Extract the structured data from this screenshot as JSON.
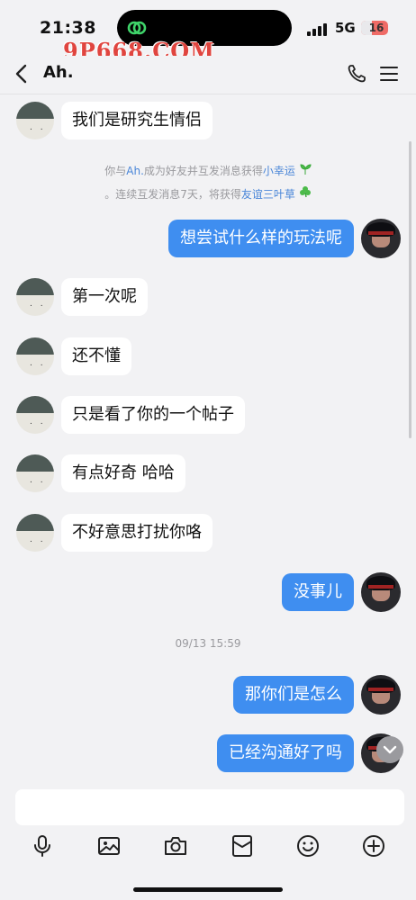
{
  "status": {
    "time": "21:38",
    "network": "5G",
    "battery": "16",
    "watermark": "9P668.COM"
  },
  "header": {
    "title": "Ah."
  },
  "system_notice": {
    "line1_prefix": "你与",
    "line1_name": "Ah.",
    "line1_middle": "成为好友并互发消息获得",
    "line1_reward": "小幸运",
    "line2_prefix": "。连续互发消息7天，将获得",
    "line2_reward": "友谊三叶草"
  },
  "messages": [
    {
      "side": "left",
      "text": "我们是研究生情侣"
    },
    {
      "side": "right",
      "text": "想尝试什么样的玩法呢"
    },
    {
      "side": "left",
      "text": "第一次呢"
    },
    {
      "side": "left",
      "text": "还不懂"
    },
    {
      "side": "left",
      "text": "只是看了你的一个帖子"
    },
    {
      "side": "left",
      "text": "有点好奇 哈哈"
    },
    {
      "side": "left",
      "text": "不好意思打扰你咯"
    },
    {
      "side": "right",
      "text": "没事儿"
    },
    {
      "side": "right",
      "text": "那你们是怎么"
    },
    {
      "side": "right",
      "text": "已经沟通好了吗"
    }
  ],
  "timestamp": "09/13 15:59",
  "input": {
    "value": "",
    "placeholder": ""
  },
  "toolbar": [
    "microphone-icon",
    "image-icon",
    "camera-icon",
    "red-packet-icon",
    "emoji-icon",
    "plus-icon"
  ],
  "colors": {
    "accent": "#3f8ef0",
    "link": "#4a86d8",
    "watermark": "#e0453f"
  }
}
